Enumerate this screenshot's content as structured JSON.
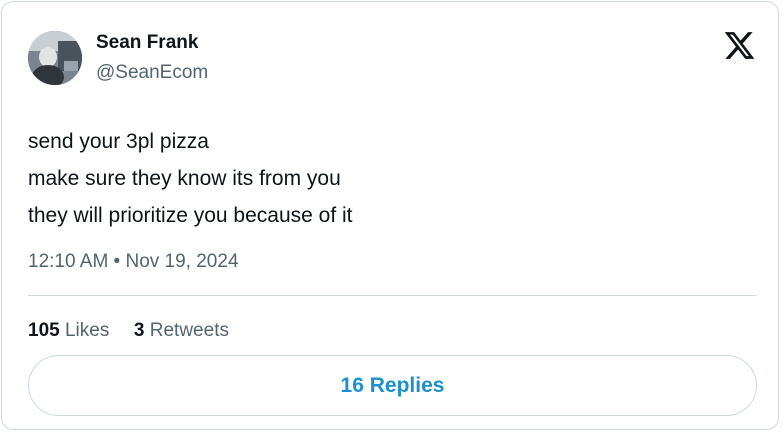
{
  "author": {
    "display_name": "Sean Frank",
    "handle": "@SeanEcom"
  },
  "icons": {
    "logo": "x-logo-icon",
    "avatar": "avatar"
  },
  "tweet": {
    "lines": [
      "send your 3pl pizza",
      "make sure they know its from you",
      "they will prioritize you because of it"
    ],
    "timestamp": "12:10 AM • Nov 19, 2024"
  },
  "stats": {
    "likes_count": "105",
    "likes_label": "Likes",
    "retweets_count": "3",
    "retweets_label": "Retweets"
  },
  "replies_button": {
    "label": "16 Replies"
  },
  "colors": {
    "text": "#0f1419",
    "secondary": "#536471",
    "border": "#cfd9de",
    "link": "#1d8fce"
  }
}
